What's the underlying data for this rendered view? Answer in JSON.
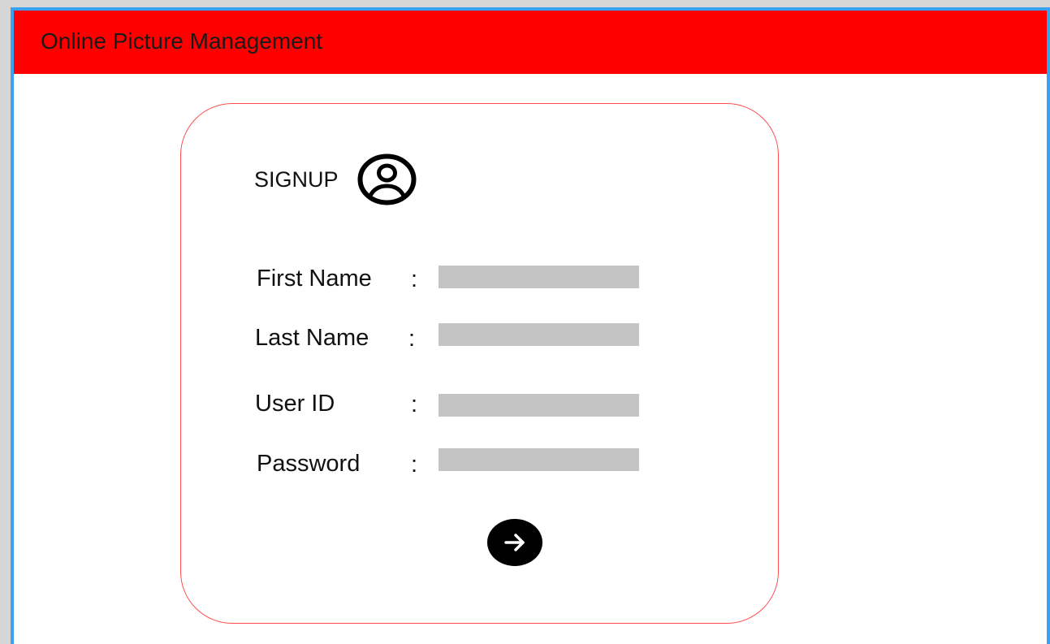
{
  "header": {
    "title": "Online Picture Management",
    "background_color": "#ff0000"
  },
  "signup": {
    "title": "SIGNUP",
    "title_icon": "account-circle-icon",
    "fields": [
      {
        "label": "First Name",
        "separator": ":",
        "value": ""
      },
      {
        "label": "Last Name",
        "separator": ":",
        "value": ""
      },
      {
        "label": "User ID",
        "separator": ":",
        "value": ""
      },
      {
        "label": "Password",
        "separator": ":",
        "value": ""
      }
    ],
    "submit_icon": "arrow-right-icon",
    "card_border_color": "#ff4d4d",
    "input_color": "#c4c4c4"
  },
  "window": {
    "border_color": "#3aa0f0"
  }
}
